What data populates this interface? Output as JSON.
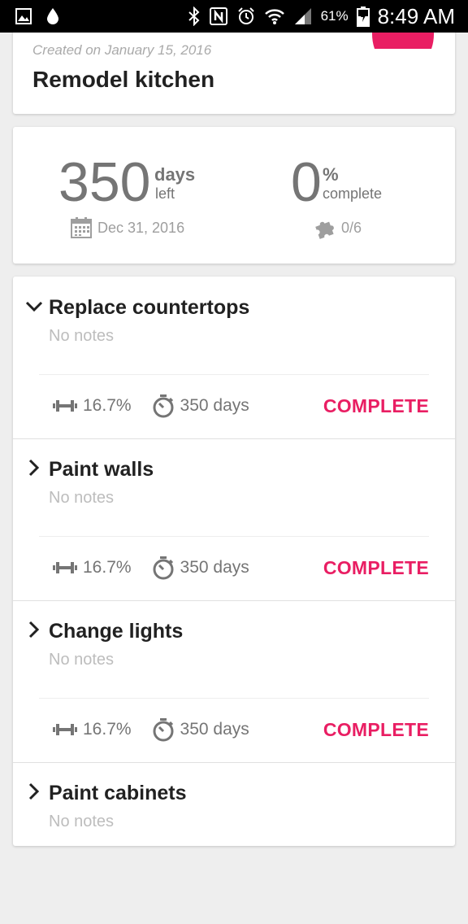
{
  "status_bar": {
    "battery": "61%",
    "time": "8:49 AM",
    "icons": [
      "image-icon",
      "water-drop-icon",
      "bluetooth-icon",
      "nfc-icon",
      "alarm-icon",
      "wifi-icon",
      "signal-icon",
      "battery-charging-icon"
    ]
  },
  "project": {
    "created": "Created on January 15, 2016",
    "title": "Remodel kitchen"
  },
  "stats": {
    "days_value": "350",
    "days_unit": "days",
    "days_sub": "left",
    "due_date": "Dec 31, 2016",
    "percent_value": "0",
    "percent_unit": "%",
    "percent_sub": "complete",
    "tasks_done": "0/6"
  },
  "tasks": [
    {
      "title": "Replace countertops",
      "notes": "No notes",
      "weight": "16.7%",
      "duration": "350 days",
      "action": "COMPLETE",
      "expanded": true
    },
    {
      "title": "Paint walls",
      "notes": "No notes",
      "weight": "16.7%",
      "duration": "350 days",
      "action": "COMPLETE",
      "expanded": false
    },
    {
      "title": "Change lights",
      "notes": "No notes",
      "weight": "16.7%",
      "duration": "350 days",
      "action": "COMPLETE",
      "expanded": false
    },
    {
      "title": "Paint cabinets",
      "notes": "No notes",
      "expanded": false
    }
  ],
  "colors": {
    "accent": "#e91e63",
    "text_primary": "#212121",
    "text_secondary": "#757575"
  }
}
